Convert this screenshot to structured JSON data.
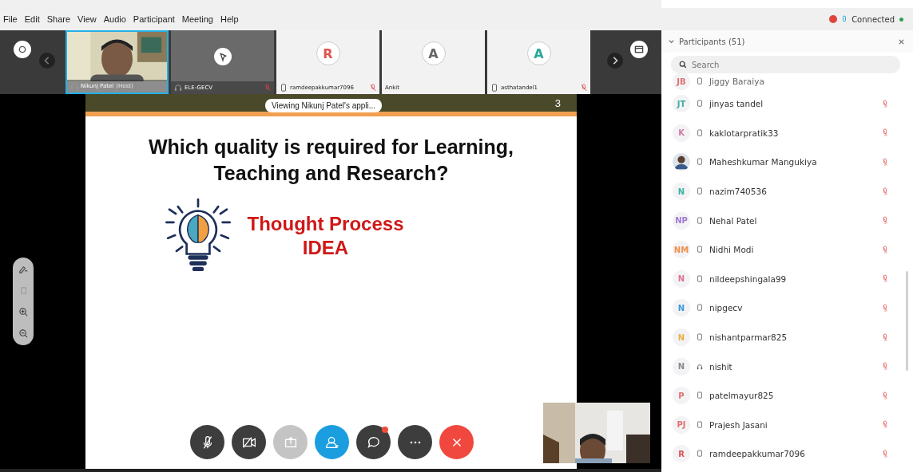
{
  "menu": [
    "File",
    "Edit",
    "Share",
    "View",
    "Audio",
    "Participant",
    "Meeting",
    "Help"
  ],
  "status": {
    "recording": true,
    "label": "Connected",
    "connected": true
  },
  "tiles": [
    {
      "kind": "video",
      "name": "Nikunj Patel",
      "role": "(Host)",
      "selected": true,
      "headset": true,
      "phone": false,
      "muted": false
    },
    {
      "kind": "blank",
      "name": "ELE-GECV",
      "selected": false,
      "headset": true,
      "phone": false,
      "muted": true
    },
    {
      "kind": "avatar",
      "initial": "R",
      "color": "#e0544e",
      "name": "ramdeepakkumar7096",
      "selected": false,
      "headset": false,
      "phone": true,
      "muted": true
    },
    {
      "kind": "avatar",
      "initial": "A",
      "color": "#666666",
      "name": "Ankit",
      "selected": false,
      "headset": false,
      "phone": false,
      "muted": false
    },
    {
      "kind": "avatar",
      "initial": "A",
      "color": "#2aa89a",
      "name": "asthatandel1",
      "selected": false,
      "headset": false,
      "phone": true,
      "muted": true
    }
  ],
  "share_banner": "Viewing Nikunj  Patel's appli...",
  "slide": {
    "number": "3",
    "title": "Which quality is required for Learning, Teaching and Research?",
    "subtitle": [
      "Thought Process",
      "IDEA"
    ]
  },
  "annotation_tools": [
    {
      "kind": "pen",
      "disabled": false
    },
    {
      "kind": "eraser",
      "disabled": true
    },
    {
      "kind": "zoom-in",
      "disabled": false
    },
    {
      "kind": "zoom-out",
      "disabled": false
    }
  ],
  "controls": [
    {
      "kind": "mute",
      "disabled": false
    },
    {
      "kind": "video",
      "disabled": false
    },
    {
      "kind": "share",
      "disabled": true
    },
    {
      "kind": "participants",
      "disabled": false
    },
    {
      "kind": "chat",
      "disabled": false,
      "unread": true
    },
    {
      "kind": "more",
      "disabled": false
    },
    {
      "kind": "leave",
      "disabled": false
    }
  ],
  "panel": {
    "title": "Participants (51)",
    "search": {
      "placeholder": "Search"
    },
    "participants": [
      {
        "kind": "phone",
        "photo": false,
        "initials": "JB",
        "color": "#e07070",
        "name": "Jiggy Baraiya"
      },
      {
        "kind": "phone",
        "photo": false,
        "initials": "JT",
        "color": "#3bb0a0",
        "name": "jinyas tandel",
        "muted": true
      },
      {
        "kind": "phone",
        "photo": false,
        "initials": "K",
        "color": "#d07aa0",
        "name": "kaklotarpratik33",
        "muted": true
      },
      {
        "kind": "phone",
        "photo": true,
        "name": "Maheshkumar Mangukiya",
        "muted": true
      },
      {
        "kind": "phone",
        "photo": false,
        "initials": "N",
        "color": "#3bb0a0",
        "name": "nazim740536",
        "muted": true
      },
      {
        "kind": "phone",
        "photo": false,
        "initials": "NP",
        "color": "#a07ad0",
        "name": "Nehal Patel",
        "muted": true
      },
      {
        "kind": "phone",
        "photo": false,
        "initials": "NM",
        "color": "#f0904a",
        "name": "Nidhi Modi",
        "muted": true
      },
      {
        "kind": "phone",
        "photo": false,
        "initials": "N",
        "color": "#e07090",
        "name": "nildeepshingala99",
        "muted": true
      },
      {
        "kind": "phone",
        "photo": false,
        "initials": "N",
        "color": "#3a9ad8",
        "name": "nipgecv",
        "muted": true
      },
      {
        "kind": "phone",
        "photo": false,
        "initials": "N",
        "color": "#e8b040",
        "name": "nishantparmar825",
        "muted": true
      },
      {
        "kind": "headset",
        "photo": false,
        "initials": "N",
        "color": "#888888",
        "name": "nishit",
        "muted": true
      },
      {
        "kind": "phone",
        "photo": false,
        "initials": "P",
        "color": "#e07070",
        "name": "patelmayur825",
        "muted": true
      },
      {
        "kind": "phone",
        "photo": false,
        "initials": "PJ",
        "color": "#e07070",
        "name": "Prajesh Jasani",
        "muted": true
      },
      {
        "kind": "phone",
        "photo": false,
        "initials": "R",
        "color": "#e05050",
        "name": "ramdeepakkumar7096",
        "muted": true
      }
    ]
  }
}
